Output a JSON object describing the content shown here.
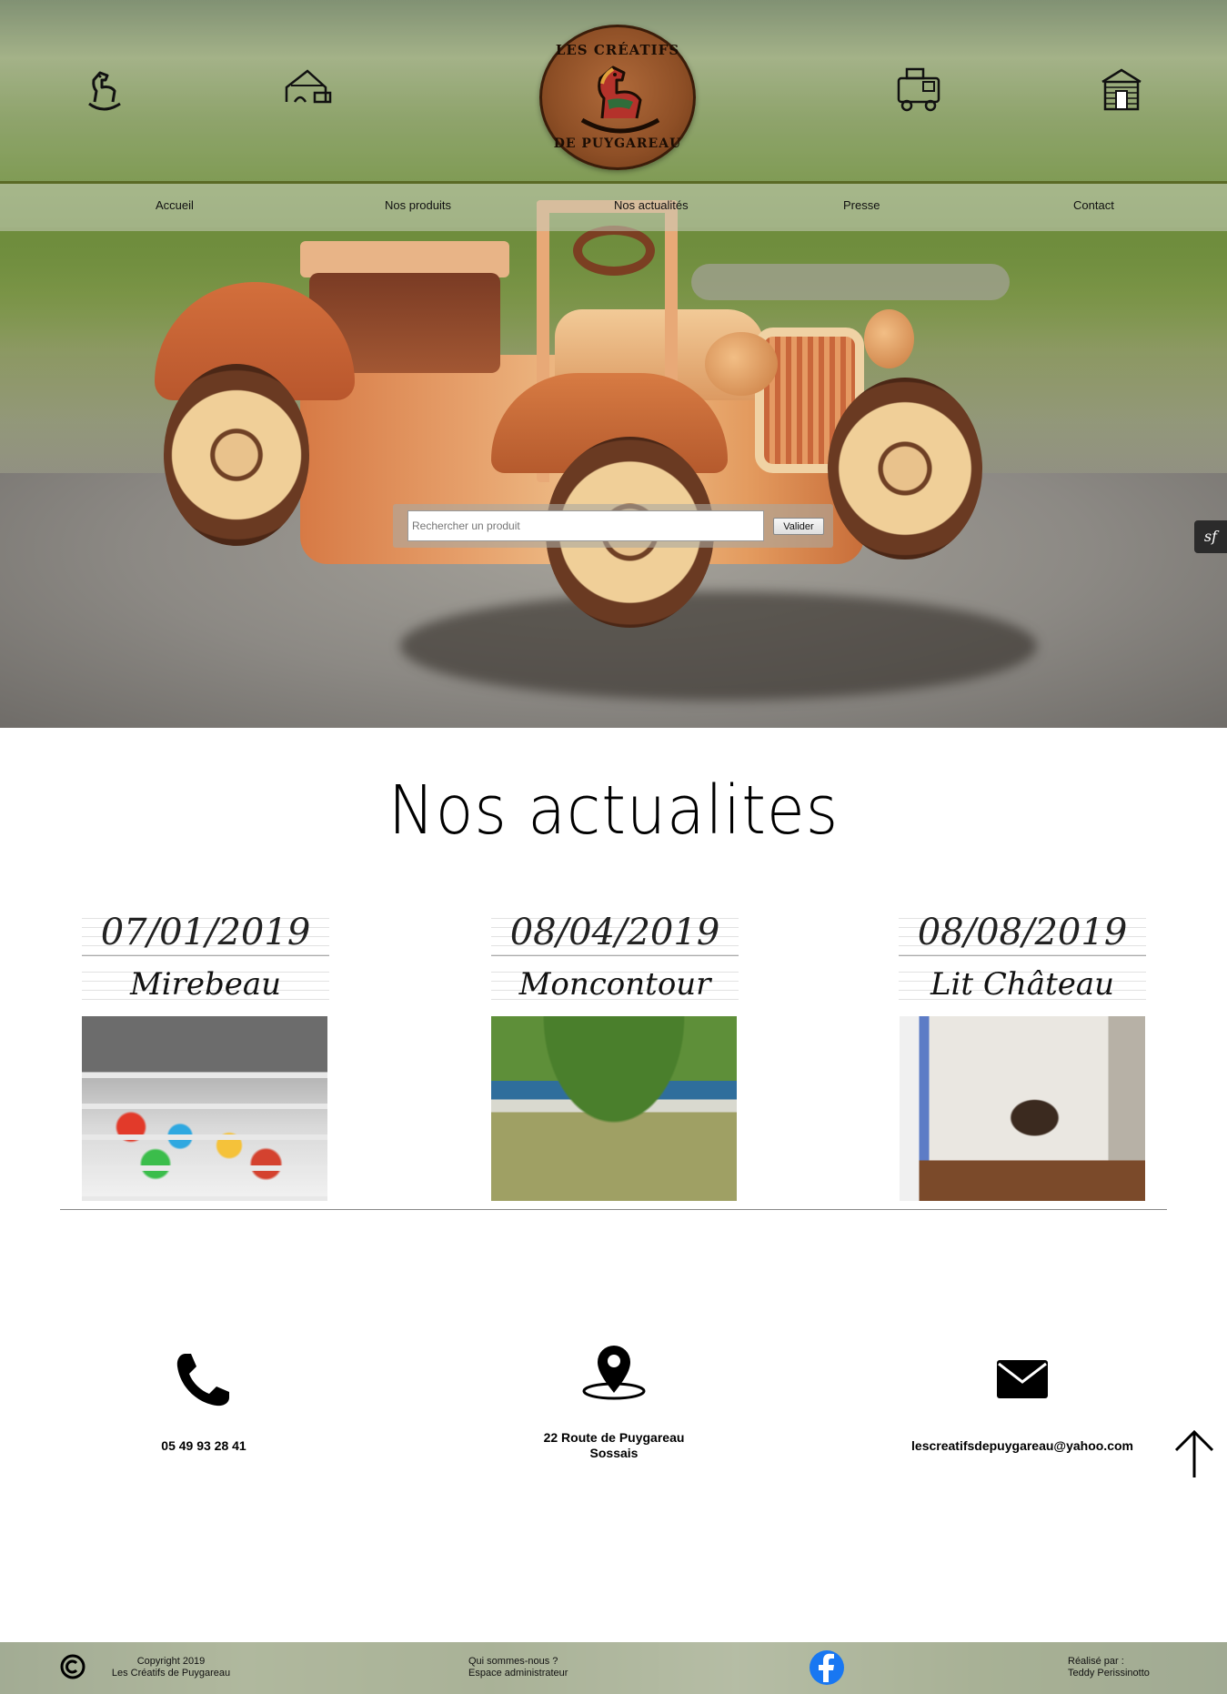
{
  "nav": {
    "items": [
      {
        "label": "Accueil"
      },
      {
        "label": "Nos produits"
      },
      {
        "label": "Nos actualités"
      },
      {
        "label": "Presse"
      },
      {
        "label": "Contact"
      }
    ]
  },
  "logo": {
    "top_text": "LES CRÉATIFS",
    "bottom_text": "DE PUYGAREAU"
  },
  "header_icons": [
    "rocking-horse-icon",
    "toy-blocks-icon",
    "toy-train-icon",
    "log-cabin-icon"
  ],
  "search": {
    "placeholder": "Rechercher un produit",
    "value": "",
    "button_label": "Valider"
  },
  "debug_badge": {
    "label": "sf"
  },
  "news": {
    "title": "Nos actualites",
    "items": [
      {
        "date": "07/01/2019",
        "place": "Mirebeau"
      },
      {
        "date": "08/04/2019",
        "place": "Moncontour"
      },
      {
        "date": "08/08/2019",
        "place": "Lit Château"
      }
    ]
  },
  "contact": {
    "phone": "05 49 93 28 41",
    "address_line1": "22 Route de Puygareau",
    "address_line2": "Sossais",
    "email": "lescreatifsdepuygareau@yahoo.com"
  },
  "footer": {
    "copyright_line1": "Copyright 2019",
    "copyright_line2": "Les Créatifs de Puygareau",
    "link_about": "Qui sommes-nous ?",
    "link_admin": "Espace administrateur",
    "credit_line1": "Réalisé par :",
    "credit_line2": "Teddy Perissinotto"
  },
  "colors": {
    "nav_line": "#5a6a25",
    "facebook_blue": "#1877f2",
    "logo_wood": "#8e4f26"
  }
}
